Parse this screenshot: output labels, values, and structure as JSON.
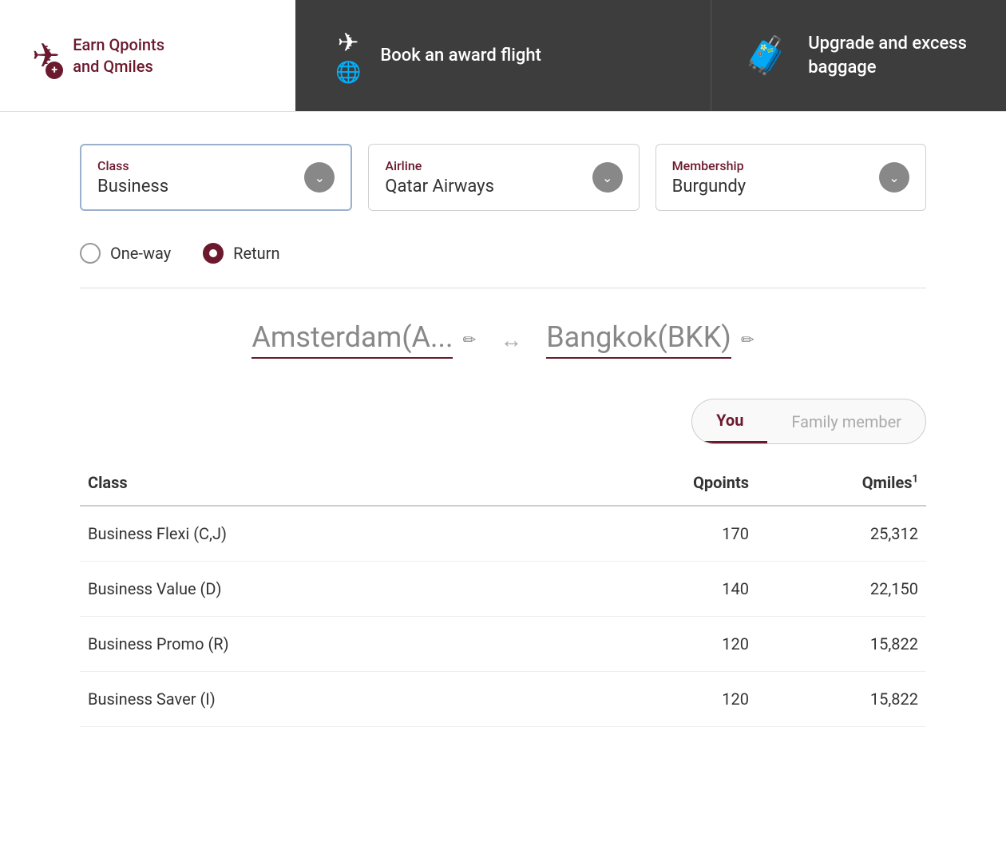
{
  "nav": {
    "earn_label": "Earn Qpoints\nand Qmiles",
    "book_label": "Book an\naward flight",
    "upgrade_label": "Upgrade and\nexcess baggage"
  },
  "filters": {
    "class_label": "Class",
    "class_value": "Business",
    "airline_label": "Airline",
    "airline_value": "Qatar Airways",
    "membership_label": "Membership",
    "membership_value": "Burgundy"
  },
  "trip_type": {
    "one_way_label": "One-way",
    "return_label": "Return"
  },
  "route": {
    "origin": "Amsterdam(A...",
    "destination": "Bangkok(BKK)"
  },
  "passengers": {
    "you_label": "You",
    "family_member_label": "Family member"
  },
  "table": {
    "col_class": "Class",
    "col_qpoints": "Qpoints",
    "col_qmiles": "Qmiles",
    "qmiles_superscript": "1",
    "rows": [
      {
        "class": "Business Flexi (C,J)",
        "qpoints": "170",
        "qmiles": "25,312"
      },
      {
        "class": "Business Value (D)",
        "qpoints": "140",
        "qmiles": "22,150"
      },
      {
        "class": "Business Promo (R)",
        "qpoints": "120",
        "qmiles": "15,822"
      },
      {
        "class": "Business Saver (I)",
        "qpoints": "120",
        "qmiles": "15,822"
      }
    ]
  }
}
